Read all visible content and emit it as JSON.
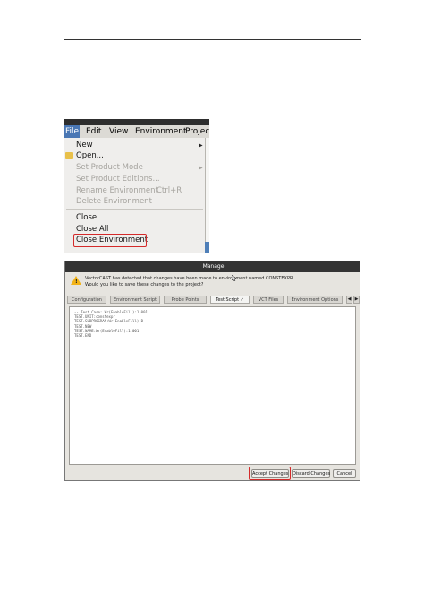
{
  "menu_shot": {
    "menubar": [
      "File",
      "Edit",
      "View",
      "Environment",
      "Project"
    ],
    "items": [
      {
        "label": "New",
        "enabled": true,
        "submenu": true
      },
      {
        "label": "Open...",
        "enabled": true
      },
      {
        "label": "Set Product Mode",
        "enabled": false,
        "submenu": true
      },
      {
        "label": "Set Product Editions...",
        "enabled": false
      },
      {
        "label": "Rename Environment",
        "enabled": false,
        "shortcut": "Ctrl+R"
      },
      {
        "label": "Delete Environment",
        "enabled": false
      },
      {
        "label": "Close",
        "enabled": true
      },
      {
        "label": "Close All",
        "enabled": true
      },
      {
        "label": "Close Environment",
        "enabled": true,
        "highlighted": true
      }
    ]
  },
  "dialog": {
    "title": "Manage",
    "message_line1": "VectorCAST has detected that changes have been made to environment named CONSTEXPR.",
    "message_line2": "Would you like to save these changes to the project?",
    "tabs": [
      "Configuration",
      "Environment Script",
      "Probe Points",
      "Test Script",
      "VCT Files",
      "Environment Options"
    ],
    "active_tab": "Test Script",
    "code_lines": [
      "-- Test Case: Wr(EnableFill):1.001",
      "TEST.UNIT:constexpr",
      "TEST.SUBPROGRAM:Wr(EnableFill):B",
      "TEST.NEW",
      "TEST.NAME:Wr(EnableFill):1.001",
      "TEST.END"
    ],
    "buttons": {
      "accept": "Accept Changes",
      "discard": "Discard Changes",
      "cancel": "Cancel"
    }
  },
  "colors": {
    "highlight_border": "#d42a2a",
    "menu_active": "#4a77b4",
    "warning": "#f2b317"
  }
}
